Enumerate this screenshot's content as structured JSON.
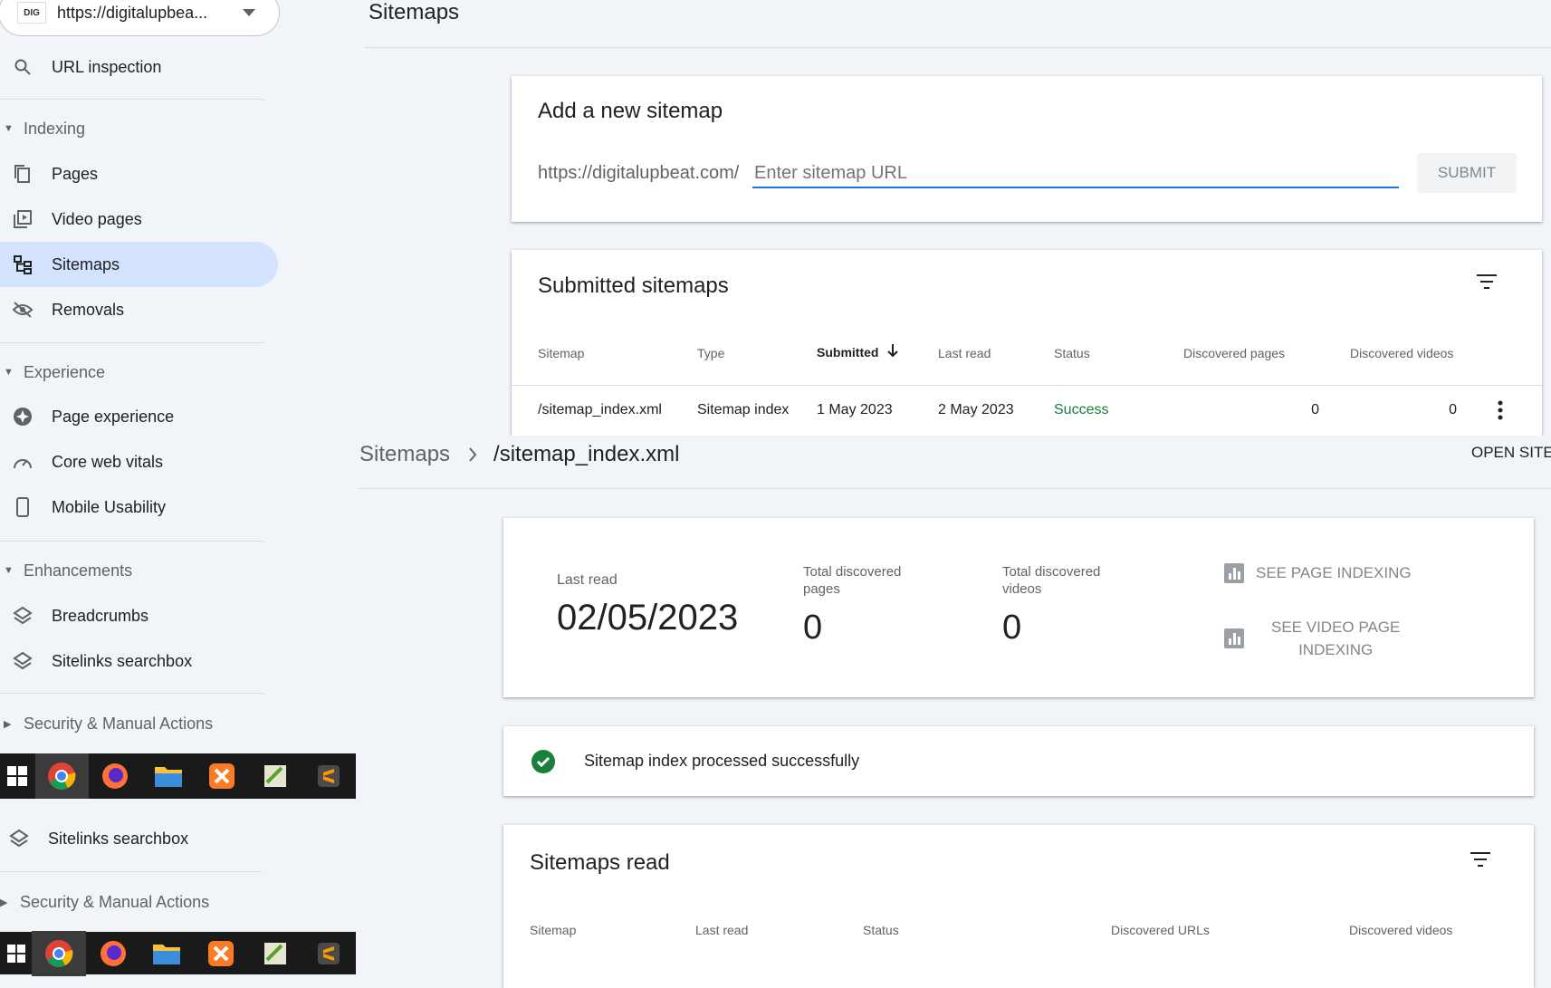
{
  "property": {
    "badge": "DIG",
    "url": "https://digitalupbea..."
  },
  "sidebar": {
    "url_inspection": "URL inspection",
    "indexing": {
      "header": "Indexing",
      "items": [
        "Pages",
        "Video pages",
        "Sitemaps",
        "Removals"
      ]
    },
    "experience": {
      "header": "Experience",
      "items": [
        "Page experience",
        "Core web vitals",
        "Mobile Usability"
      ]
    },
    "enhancements": {
      "header": "Enhancements",
      "items": [
        "Breadcrumbs",
        "Sitelinks searchbox"
      ]
    },
    "security": "Security & Manual Actions",
    "lower": {
      "item": "Sitelinks searchbox",
      "security": "Security & Manual Actions"
    }
  },
  "page_title": "Sitemaps",
  "add_sitemap": {
    "title": "Add a new sitemap",
    "prefix": "https://digitalupbeat.com/",
    "placeholder": "Enter sitemap URL",
    "submit": "SUBMIT"
  },
  "submitted": {
    "title": "Submitted sitemaps",
    "columns": [
      "Sitemap",
      "Type",
      "Submitted",
      "Last read",
      "Status",
      "Discovered pages",
      "Discovered videos"
    ],
    "row": {
      "sitemap": "/sitemap_index.xml",
      "type": "Sitemap index",
      "submitted": "1 May 2023",
      "last_read": "2 May 2023",
      "status": "Success",
      "pages": "0",
      "videos": "0"
    }
  },
  "breadcrumb": {
    "root": "Sitemaps",
    "current": "/sitemap_index.xml",
    "open_site": "OPEN SITE"
  },
  "summary": {
    "last_read_label": "Last read",
    "last_read_value": "02/05/2023",
    "pages_label_1": "Total discovered",
    "pages_label_2": "pages",
    "pages_value": "0",
    "videos_label_1": "Total discovered",
    "videos_label_2": "videos",
    "videos_value": "0",
    "see_page_indexing": "SEE PAGE INDEXING",
    "see_video_1": "SEE VIDEO PAGE",
    "see_video_2": "INDEXING"
  },
  "status_message": "Sitemap index processed successfully",
  "sitemaps_read": {
    "title": "Sitemaps read",
    "columns": [
      "Sitemap",
      "Last read",
      "Status",
      "Discovered URLs",
      "Discovered videos"
    ]
  },
  "colors": {
    "accent": "#1a73e8",
    "success": "#188038",
    "active_nav": "#d3e3fd",
    "taskbar": "#1a1a1a"
  }
}
